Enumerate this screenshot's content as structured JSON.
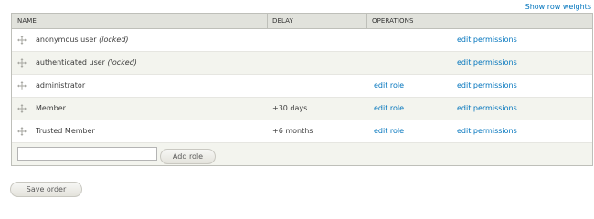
{
  "show_row_weights": "Show row weights",
  "table": {
    "headers": {
      "name": "NAME",
      "delay": "DELAY",
      "operations": "OPERATIONS"
    },
    "rows": [
      {
        "name": "anonymous user",
        "suffix": "(locked)",
        "delay": "",
        "edit_role": "",
        "edit_permissions": "edit permissions"
      },
      {
        "name": "authenticated user",
        "suffix": "(locked)",
        "delay": "",
        "edit_role": "",
        "edit_permissions": "edit permissions"
      },
      {
        "name": "administrator",
        "suffix": "",
        "delay": "",
        "edit_role": "edit role",
        "edit_permissions": "edit permissions"
      },
      {
        "name": "Member",
        "suffix": "",
        "delay": "+30 days",
        "edit_role": "edit role",
        "edit_permissions": "edit permissions"
      },
      {
        "name": "Trusted Member",
        "suffix": "",
        "delay": "+6 months",
        "edit_role": "edit role",
        "edit_permissions": "edit permissions"
      }
    ]
  },
  "add_role": {
    "input_value": "",
    "button_label": "Add role"
  },
  "save_order_label": "Save order",
  "colors": {
    "link": "#0074bd",
    "header_bg": "#e1e2dc",
    "even_row_bg": "#f3f4ee"
  },
  "icons": {
    "drag_handle": "drag-handle-icon"
  }
}
